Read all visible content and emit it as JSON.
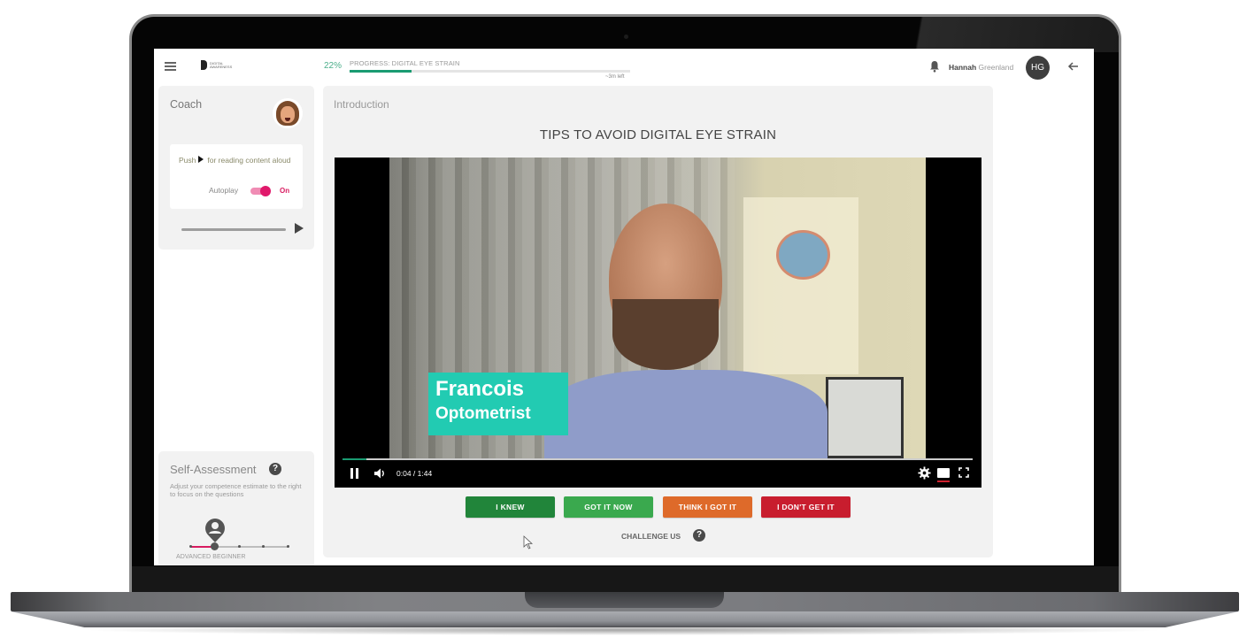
{
  "topbar": {
    "logo_text": "DIGITAL AWARENESS",
    "progress_percent_label": "22%",
    "progress_fraction": 0.22,
    "progress_label": "PROGRESS: DIGITAL EYE STRAIN",
    "time_left": "~3m left",
    "user_first_name": "Hannah",
    "user_last_name": "Greenland",
    "user_initials": "HG",
    "icons": [
      "menu-icon",
      "logo",
      "bell-icon",
      "back-arrow-icon"
    ]
  },
  "coach": {
    "title": "Coach",
    "push_prefix": "Push",
    "push_suffix": "for reading content aloud",
    "autoplay_label": "Autoplay",
    "autoplay_state": "On",
    "autoplay_enabled": true,
    "audio_progress_fraction": 0.0
  },
  "self_assessment": {
    "title": "Self-Assessment",
    "help_glyph": "?",
    "description": "Adjust your competence estimate to the right to focus on the questions",
    "levels_count": 5,
    "selected_level_index": 1,
    "selected_level_label": "ADVANCED BEGINNER"
  },
  "main": {
    "section_label": "Introduction",
    "lesson_title": "TIPS TO AVOID DIGITAL EYE STRAIN",
    "video": {
      "caption_name": "Francois",
      "caption_role": "Optometrist",
      "time_display": "0:04 / 1:44",
      "current_seconds": 4,
      "duration_seconds": 104,
      "playing": true,
      "captions_on": true
    },
    "answer_buttons": [
      {
        "label": "I KNEW",
        "color": "#21853a"
      },
      {
        "label": "GOT IT NOW",
        "color": "#3aa94e"
      },
      {
        "label": "THINK I GOT IT",
        "color": "#de6a2a"
      },
      {
        "label": "I DON'T GET IT",
        "color": "#c81d2e"
      }
    ],
    "challenge_label": "CHALLENGE US",
    "challenge_help_glyph": "?"
  },
  "colors": {
    "accent_green": "#1a9b72",
    "accent_pink": "#d81b60",
    "caption_teal": "#22cbb2"
  }
}
